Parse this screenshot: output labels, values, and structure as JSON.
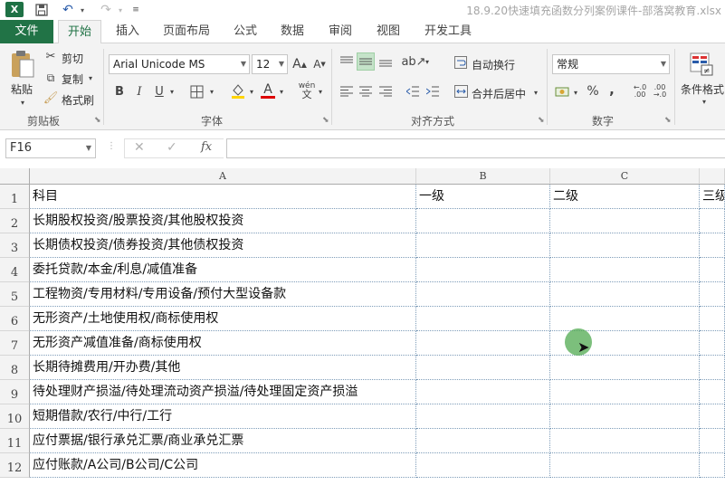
{
  "window": {
    "title": "18.9.20快速填充函数分列案例课件-部落窝教育.xlsx",
    "app_logo": "X"
  },
  "tabs": [
    {
      "label": "文件"
    },
    {
      "label": "开始"
    },
    {
      "label": "插入"
    },
    {
      "label": "页面布局"
    },
    {
      "label": "公式"
    },
    {
      "label": "数据"
    },
    {
      "label": "审阅"
    },
    {
      "label": "视图"
    },
    {
      "label": "开发工具"
    }
  ],
  "ribbon": {
    "clipboard": {
      "label": "剪贴板",
      "paste": "粘贴",
      "cut": "剪切",
      "copy": "复制",
      "format_painter": "格式刷"
    },
    "font": {
      "label": "字体",
      "font_name": "Arial Unicode MS",
      "font_size": "12",
      "grow": "A",
      "shrink": "A",
      "bold": "B",
      "italic": "I",
      "underline": "U",
      "font_color_glyph": "A",
      "phonetic": "wén"
    },
    "alignment": {
      "label": "对齐方式",
      "wrap_text": "自动换行",
      "merge_center": "合并后居中"
    },
    "number": {
      "label": "数字",
      "format": "常规",
      "percent": "%",
      "comma": ","
    },
    "styles": {
      "conditional_format": "条件格式"
    }
  },
  "formula_bar": {
    "name_box": "F16",
    "fx": "fx",
    "cancel": "✕",
    "enter": "✓",
    "content": ""
  },
  "grid": {
    "columns": [
      "A",
      "B",
      "C"
    ],
    "row_numbers": [
      "1",
      "2",
      "3",
      "4",
      "5",
      "6",
      "7",
      "8",
      "9",
      "10",
      "11",
      "12"
    ],
    "rows": [
      [
        "科目",
        "一级",
        "二级",
        "三级"
      ],
      [
        "长期股权投资/股票投资/其他股权投资",
        "",
        "",
        ""
      ],
      [
        "长期债权投资/债券投资/其他债权投资",
        "",
        "",
        ""
      ],
      [
        "委托贷款/本金/利息/减值准备",
        "",
        "",
        ""
      ],
      [
        "工程物资/专用材料/专用设备/预付大型设备款",
        "",
        "",
        ""
      ],
      [
        "无形资产/土地使用权/商标使用权",
        "",
        "",
        ""
      ],
      [
        "无形资产减值准备/商标使用权",
        "",
        "",
        ""
      ],
      [
        "长期待摊费用/开办费/其他",
        "",
        "",
        ""
      ],
      [
        "待处理财产损溢/待处理流动资产损溢/待处理固定资产损溢",
        "",
        "",
        ""
      ],
      [
        "短期借款/农行/中行/工行",
        "",
        "",
        ""
      ],
      [
        "应付票据/银行承兑汇票/商业承兑汇票",
        "",
        "",
        ""
      ],
      [
        "应付账款/A公司/B公司/C公司",
        "",
        "",
        ""
      ]
    ]
  },
  "colors": {
    "brand": "#217346",
    "ribbon_bg": "#f3f3f3",
    "highlight": "#c5e3c9"
  }
}
